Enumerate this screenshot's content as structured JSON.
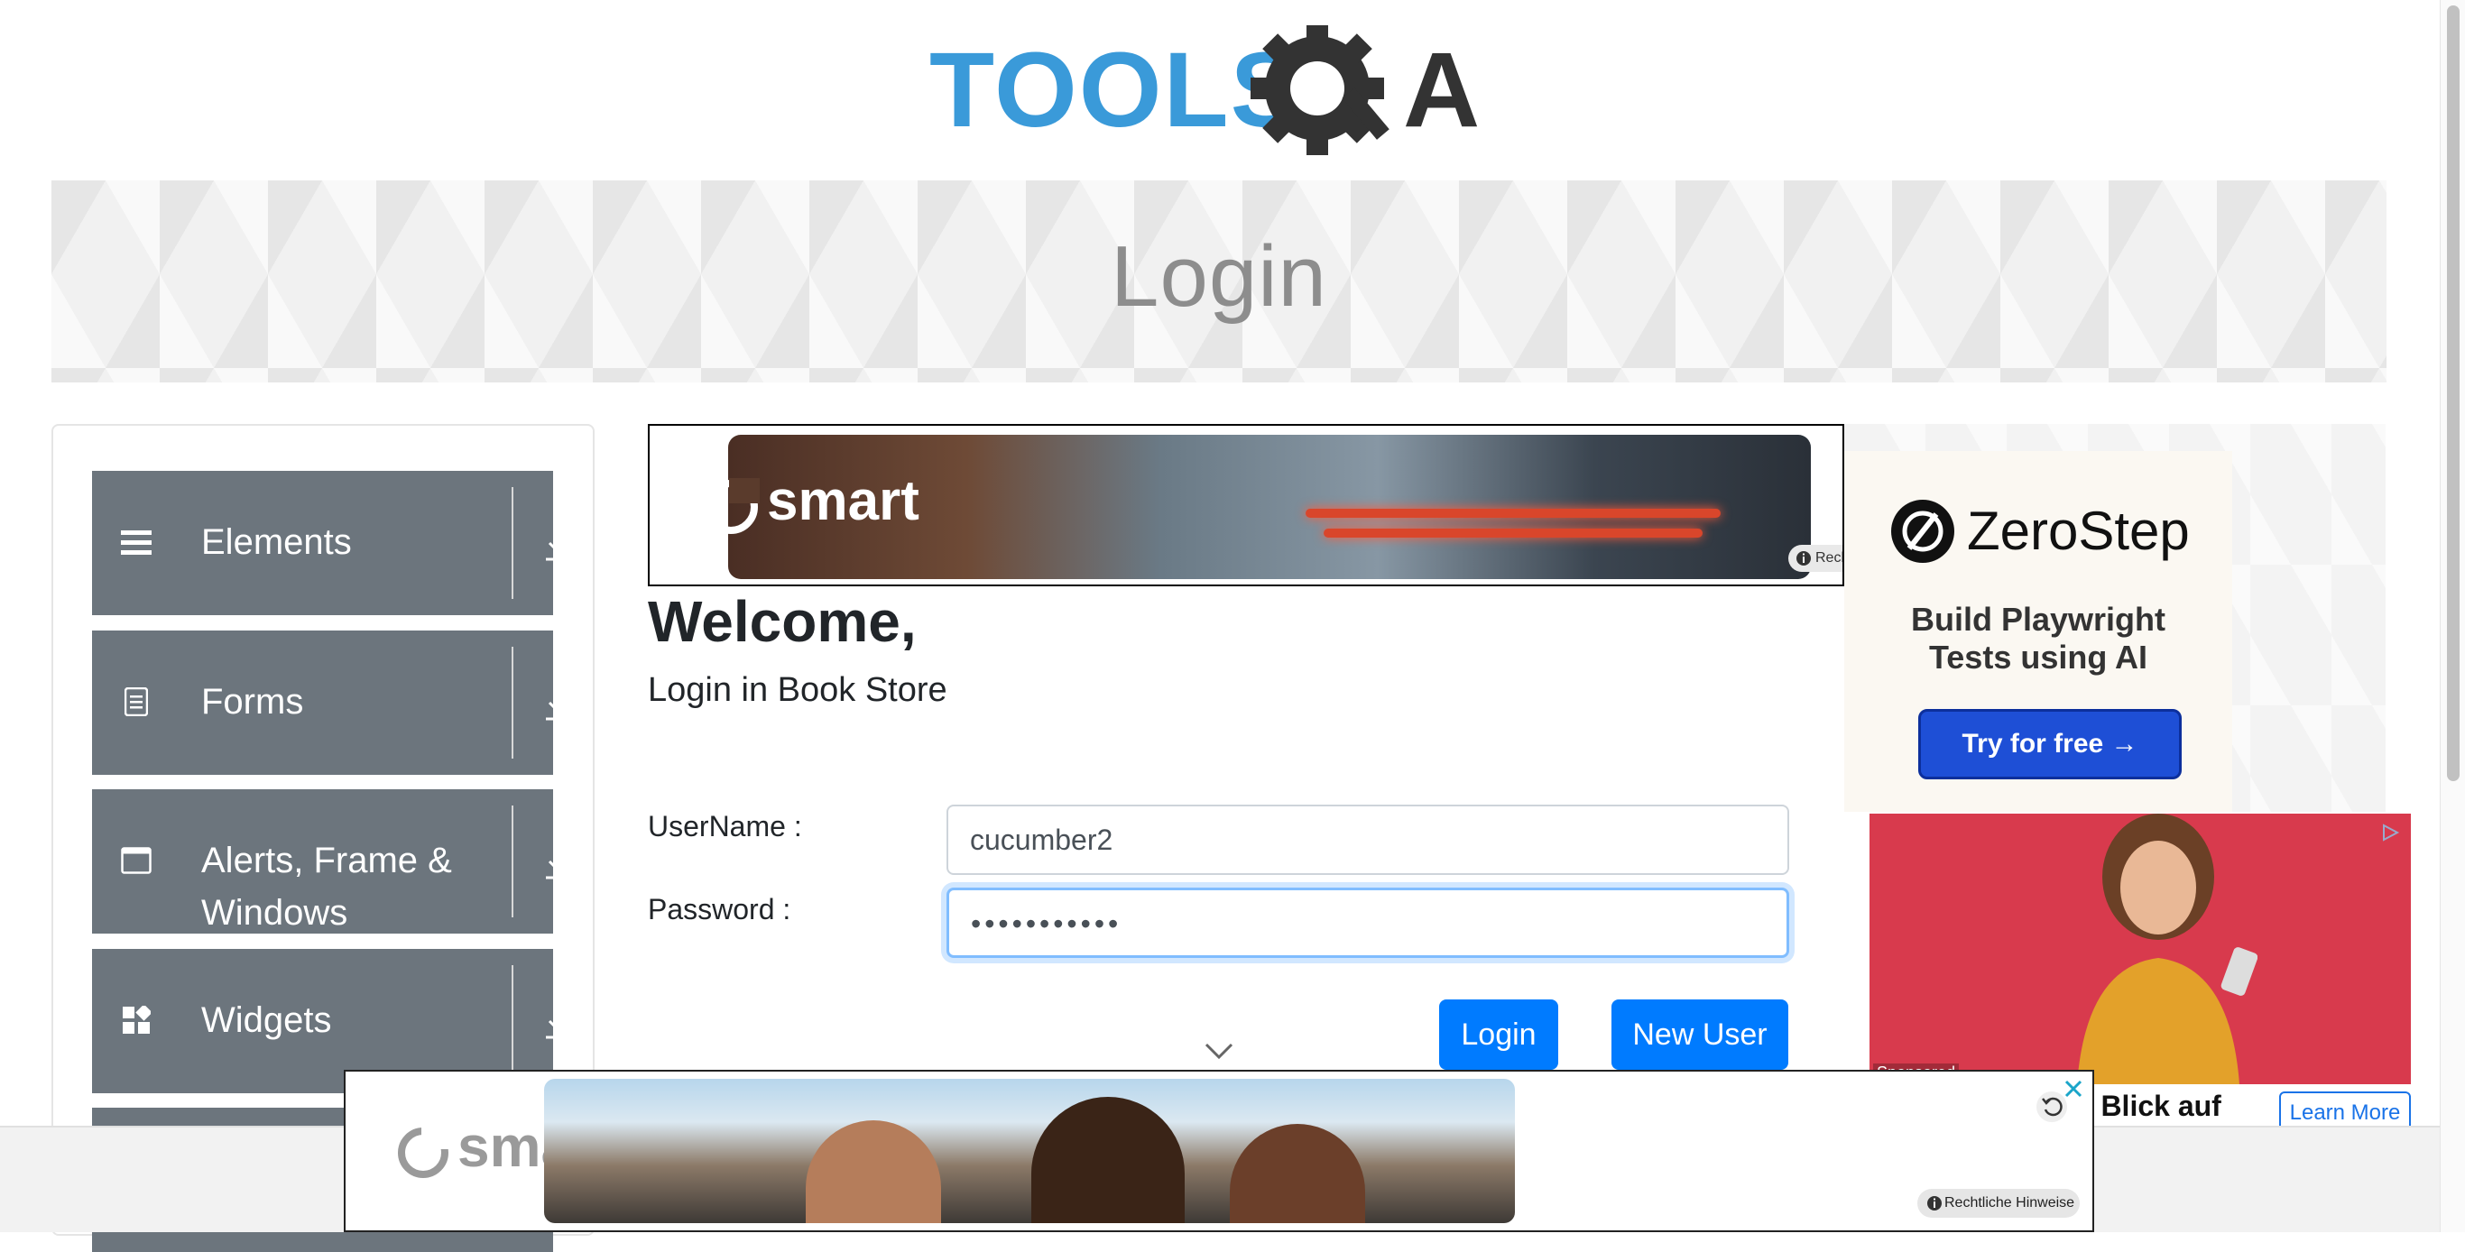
{
  "brand": {
    "logo_text_left": "TOOLS",
    "logo_text_right": "A",
    "logo_color": "#3a9ad9",
    "gear_color": "#333333"
  },
  "banner": {
    "title": "Login"
  },
  "nav": {
    "groups": [
      {
        "label": "Elements",
        "icon": "hamburger-icon"
      },
      {
        "label": "Forms",
        "icon": "document-icon"
      },
      {
        "label": "Alerts, Frame &",
        "label_line2": "Windows",
        "icon": "window-icon"
      },
      {
        "label": "Widgets",
        "icon": "widgets-icon"
      }
    ],
    "group_bg": "#6c757d"
  },
  "top_ad": {
    "brand": "smart",
    "legal": "Rechtliche Hinweise"
  },
  "login": {
    "welcome": "Welcome,",
    "subtitle": "Login in Book Store",
    "username_label": "UserName :",
    "password_label": "Password :",
    "username_value": "cucumber2",
    "password_value": "•••••••••••",
    "login_button": "Login",
    "new_user_button": "New User",
    "accent": "#007bff"
  },
  "right_ad_1": {
    "brand": "ZeroStep",
    "tagline_line1": "Build Playwright",
    "tagline_line2": "Tests using AI",
    "cta": "Try for free →"
  },
  "right_ad_2": {
    "sponsored": "Sponsored",
    "headline": "n Blick auf",
    "cta": "Learn More"
  },
  "bottom_ad": {
    "brand": "smart",
    "legal": "Rechtliche Hinweise"
  }
}
